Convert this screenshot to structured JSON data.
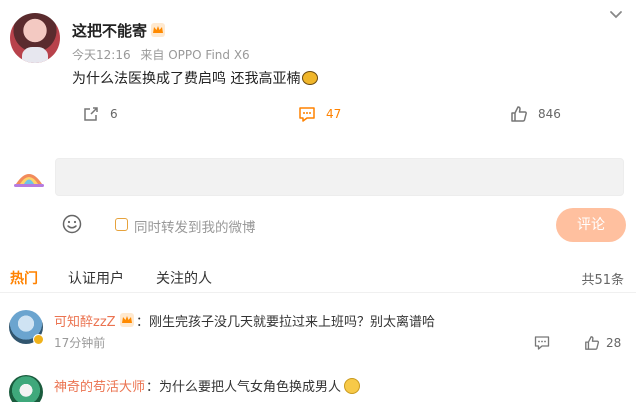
{
  "post": {
    "username": "这把不能寄",
    "time": "今天12:16",
    "source": "来自 OPPO Find X6",
    "text": "为什么法医换成了费启鸣 还我高亚楠",
    "repost_count": "6",
    "comment_count": "47",
    "like_count": "846"
  },
  "composer": {
    "repost_label": "同时转发到我的微博",
    "submit_label": "评论"
  },
  "tabs": {
    "hot": "热门",
    "verified": "认证用户",
    "following": "关注的人",
    "total": "共51条"
  },
  "comments": [
    {
      "name": "可知醉zzZ",
      "text": "：刚生完孩子没几天就要拉过来上班吗？别太离谱哈",
      "time": "17分钟前",
      "likes": "28"
    },
    {
      "name": "神奇的苟活大师",
      "text": "：为什么要把人气女角色换成男人"
    }
  ],
  "colors": {
    "accent": "#ff8200",
    "comment_name": "#eb7350",
    "submit_bg": "#ffc09f"
  }
}
